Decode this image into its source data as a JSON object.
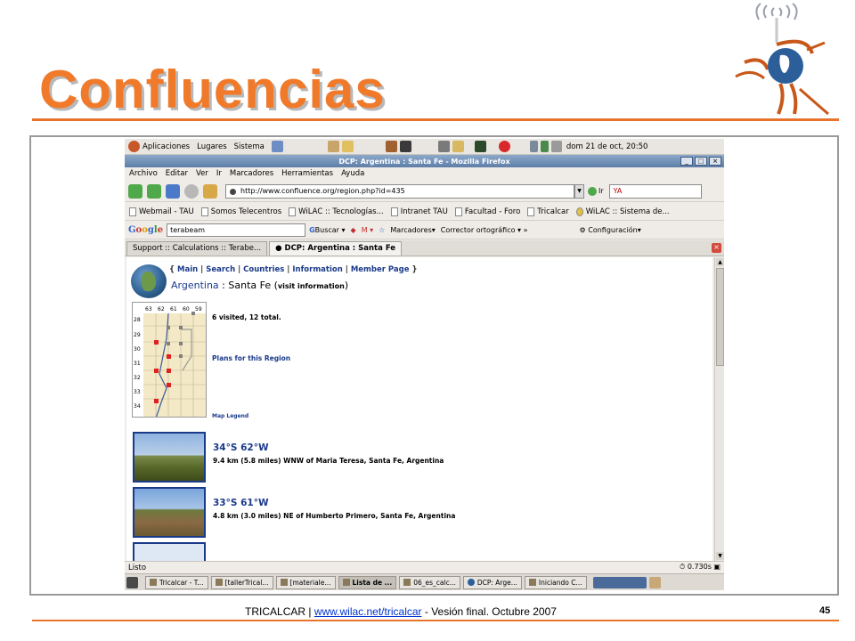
{
  "slide": {
    "title": "Confluencias",
    "footer_prefix": "TRICALCAR  |",
    "footer_link": "www.wilac.net/tricalcar",
    "footer_suffix": " - Vesión final. Octubre 2007",
    "page_number": "45"
  },
  "gnome_panel": {
    "items": [
      "Aplicaciones",
      "Lugares",
      "Sistema"
    ],
    "clock": "dom 21 de oct, 20:50"
  },
  "window": {
    "title": "DCP: Argentina : Santa Fe - Mozilla Firefox"
  },
  "menubar": [
    "Archivo",
    "Editar",
    "Ver",
    "Ir",
    "Marcadores",
    "Herramientas",
    "Ayuda"
  ],
  "navbar": {
    "url": "http://www.confluence.org/region.php?id=435",
    "go_label": "Ir"
  },
  "bookmarks": [
    "Webmail - TAU",
    "Somos Telecentros",
    "WiLAC :: Tecnologías...",
    "Intranet TAU",
    "Facultad - Foro",
    "Tricalcar",
    "WiLAC :: Sistema de..."
  ],
  "googlebar": {
    "logo": "Google",
    "query": "terabeam",
    "buscar": "Buscar",
    "marcadores": "Marcadores",
    "corrector": "Corrector ortográfico",
    "config": "Configuración"
  },
  "tabs": [
    {
      "label": "Support :: Calculations :: Terabe..."
    },
    {
      "label": "DCP: Argentina : Santa Fe"
    }
  ],
  "page": {
    "nav_open": "{ ",
    "nav_links": [
      "Main",
      "Search",
      "Countries",
      "Information",
      "Member Page"
    ],
    "nav_close": " }",
    "country": "Argentina",
    "separator": " : Santa Fe (",
    "visit_info": "visit information",
    "close_paren": ")",
    "map_cols": [
      "63",
      "62",
      "61",
      "60",
      "59"
    ],
    "map_rows": [
      "28",
      "29",
      "30",
      "31",
      "32",
      "33",
      "34"
    ],
    "visited_text": "6 visited, 12 total.",
    "plans_link": "Plans for this Region",
    "map_legend": "Map Legend",
    "entries": [
      {
        "coord": "34°S 62°W",
        "desc": "9.4 km (5.8 miles) WNW of Maria Teresa, Santa Fe, Argentina"
      },
      {
        "coord": "33°S 61°W",
        "desc": "4.8 km (3.0 miles) NE of Humberto Primero, Santa Fe, Argentina"
      }
    ]
  },
  "statusbar": {
    "text": "Listo",
    "timing": "0.730s"
  },
  "taskbar": [
    "Tricalcar - T...",
    "[tallerTrical...",
    "[materiale...",
    "Lista de ...",
    "06_es_calc...",
    "DCP: Arge...",
    "Iniciando C..."
  ],
  "colors": {
    "title_orange": "#f07a2a",
    "rule_orange": "#e8732a",
    "link_blue": "#1a3a8a",
    "visited_red": "#e02020",
    "unvisited_gray": "#808080"
  }
}
